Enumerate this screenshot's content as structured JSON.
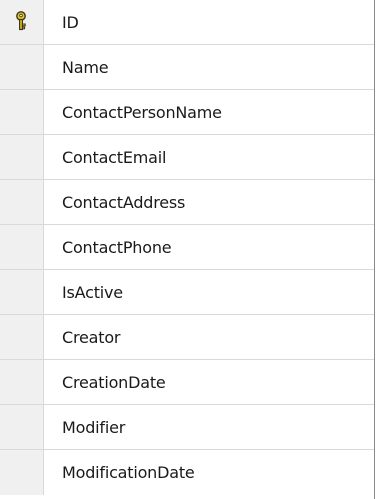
{
  "columns": [
    {
      "name": "ID",
      "primary_key": true,
      "icon": "primary-key-icon"
    },
    {
      "name": "Name"
    },
    {
      "name": "ContactPersonName"
    },
    {
      "name": "ContactEmail"
    },
    {
      "name": "ContactAddress"
    },
    {
      "name": "ContactPhone"
    },
    {
      "name": "IsActive"
    },
    {
      "name": "Creator"
    },
    {
      "name": "CreationDate"
    },
    {
      "name": "Modifier"
    },
    {
      "name": "ModificationDate"
    }
  ],
  "colors": {
    "key_body": "#e6c229",
    "key_outline": "#3a3a1a",
    "grid_line": "#d9d9d9",
    "selector_bg": "#f0f0f0"
  }
}
